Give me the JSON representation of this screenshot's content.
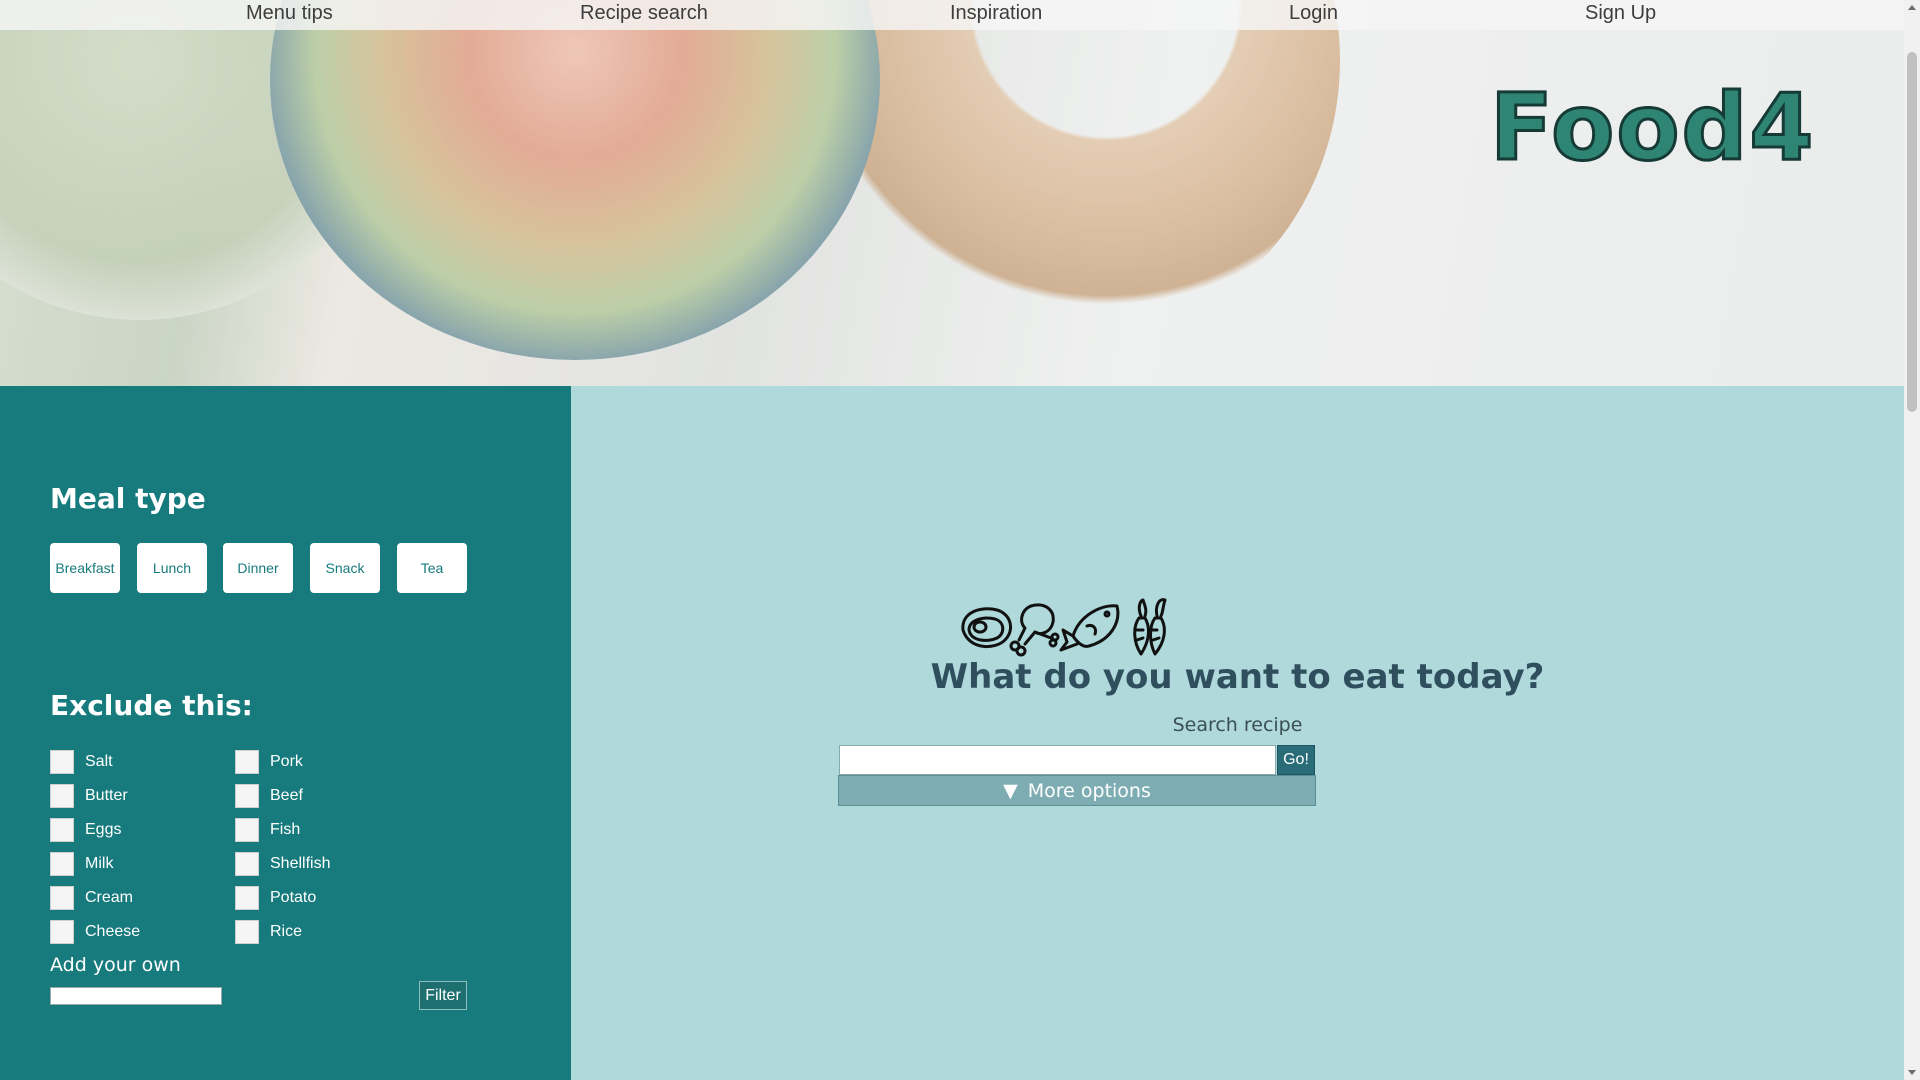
{
  "nav": {
    "items": [
      "Menu tips",
      "Recipe search",
      "Inspiration",
      "Login",
      "Sign Up"
    ]
  },
  "logo": "Food4",
  "sidebar": {
    "meal_type_title": "Meal type",
    "meal_types": [
      "Breakfast",
      "Lunch",
      "Dinner",
      "Snack",
      "Tea"
    ],
    "exclude_title": "Exclude this:",
    "exclude_left": [
      "Salt",
      "Butter",
      "Eggs",
      "Milk",
      "Cream",
      "Cheese"
    ],
    "exclude_right": [
      "Pork",
      "Beef",
      "Fish",
      "Shellfish",
      "Potato",
      "Rice"
    ],
    "add_own_label": "Add your own",
    "filter_label": "Filter"
  },
  "main": {
    "icons": [
      "steak-icon",
      "chicken-leg-icon",
      "fish-icon",
      "carrot-icon"
    ],
    "headline": "What do you want to eat today?",
    "search_label": "Search recipe",
    "go_label": "Go!",
    "more_options_label": "More options",
    "more_options_glyph": "▼"
  },
  "colors": {
    "sidebar_bg": "#177a7c",
    "main_bg": "#afd9da",
    "logo_fill": "#2f8574",
    "go_button": "#2a6d78"
  }
}
